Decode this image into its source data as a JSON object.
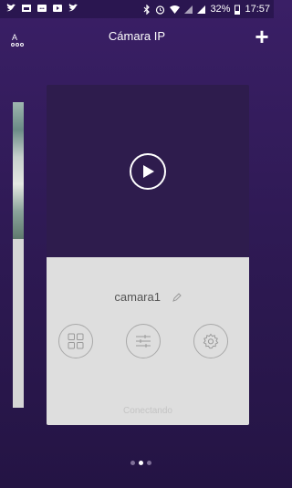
{
  "status_bar": {
    "battery": "32%",
    "time": "17:57"
  },
  "header": {
    "title": "Cámara IP",
    "menu_icon": "a-grid-icon",
    "add_label": "+"
  },
  "camera": {
    "name": "camara1",
    "status": "Conectando",
    "actions": [
      {
        "icon": "grid-icon"
      },
      {
        "icon": "sliders-icon"
      },
      {
        "icon": "gear-icon"
      }
    ]
  },
  "pager": {
    "count": 3,
    "active_index": 1
  },
  "colors": {
    "background": "#3a1f66",
    "preview": "#2e1c4d",
    "panel": "#dedede"
  }
}
